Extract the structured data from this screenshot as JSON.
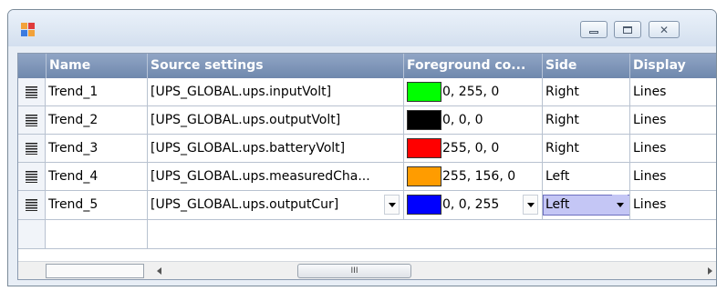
{
  "window": {
    "controls": {
      "minimize_icon": "minimize-icon",
      "maximize_icon": "maximize-icon",
      "close_glyph": "✕"
    }
  },
  "grid": {
    "columns": [
      "Name",
      "Source settings",
      "Foreground co...",
      "Side",
      "Display"
    ],
    "rows": [
      {
        "name": "Trend_1",
        "source": "[UPS_GLOBAL.ups.inputVolt]",
        "color": "#00ff00",
        "color_text": "0, 255, 0",
        "side": "Right",
        "display": "Lines"
      },
      {
        "name": "Trend_2",
        "source": "[UPS_GLOBAL.ups.outputVolt]",
        "color": "#000000",
        "color_text": "0, 0, 0",
        "side": "Right",
        "display": "Lines"
      },
      {
        "name": "Trend_3",
        "source": "[UPS_GLOBAL.ups.batteryVolt]",
        "color": "#ff0000",
        "color_text": "255, 0, 0",
        "side": "Right",
        "display": "Lines"
      },
      {
        "name": "Trend_4",
        "source": "[UPS_GLOBAL.ups.measuredCha...",
        "color": "#ff9c00",
        "color_text": "255, 156, 0",
        "side": "Left",
        "display": "Lines"
      },
      {
        "name": "Trend_5",
        "source": "[UPS_GLOBAL.ups.outputCur]",
        "color": "#0000ff",
        "color_text": "0, 0, 255",
        "side": "Left",
        "display": "Lines"
      }
    ],
    "scrollbar_grip": "III"
  }
}
